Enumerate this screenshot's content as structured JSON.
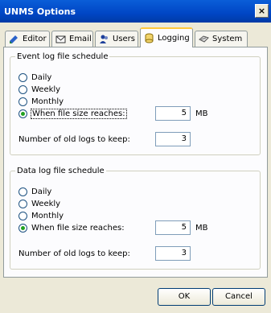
{
  "window": {
    "title": "UNMS Options",
    "close": "×"
  },
  "tabs": [
    {
      "label": "Editor",
      "icon": "editor-icon"
    },
    {
      "label": "Email",
      "icon": "email-icon"
    },
    {
      "label": "Users",
      "icon": "users-icon"
    },
    {
      "label": "Logging",
      "icon": "logging-icon",
      "active": true
    },
    {
      "label": "System",
      "icon": "system-icon"
    }
  ],
  "event_log": {
    "legend": "Event log file schedule",
    "options": [
      "Daily",
      "Weekly",
      "Monthly",
      "When file size reaches:"
    ],
    "selected": "When file size reaches:",
    "size_value": "5",
    "size_unit": "MB",
    "old_logs_label": "Number of old logs to keep:",
    "old_logs_value": "3"
  },
  "data_log": {
    "legend": "Data log file schedule",
    "options": [
      "Daily",
      "Weekly",
      "Monthly",
      "When file size reaches:"
    ],
    "selected": "When file size reaches:",
    "size_value": "5",
    "size_unit": "MB",
    "old_logs_label": "Number of old logs to keep:",
    "old_logs_value": "3"
  },
  "buttons": {
    "ok": "OK",
    "cancel": "Cancel"
  },
  "colors": {
    "titlebar": "#0046c5",
    "active_tab_accent": "#ffc83c",
    "radio_dot": "#21a121"
  }
}
